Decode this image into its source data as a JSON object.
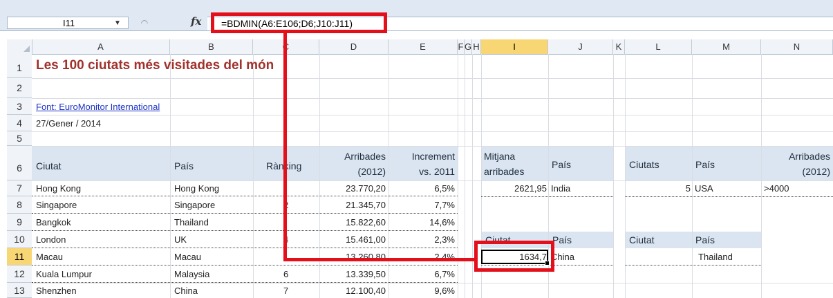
{
  "name_box": {
    "value": "I11"
  },
  "formula_bar": {
    "fx": "fx",
    "formula": "=BDMIN(A6:E106;D6;J10:J11)"
  },
  "columns": [
    "A",
    "B",
    "C",
    "D",
    "E",
    "F",
    "G",
    "H",
    "I",
    "J",
    "K",
    "L",
    "M",
    "N"
  ],
  "selected_column": "I",
  "rows": [
    "1",
    "2",
    "3",
    "4",
    "5",
    "6",
    "7",
    "8",
    "9",
    "10",
    "11",
    "12",
    "13"
  ],
  "selected_row": "11",
  "sheet": {
    "title": "Les 100 ciutats més visitades del món",
    "source": "Font: EuroMonitor International",
    "date": "27/Gener / 2014",
    "headers": {
      "ciutat": "Ciutat",
      "pais": "País",
      "ranking": "Rànking",
      "arribades_1": "Arribades",
      "arribades_2": "(2012)",
      "increment_1": "Increment",
      "increment_2": "vs. 2011"
    },
    "data_rows": [
      {
        "ciutat": "Hong Kong",
        "pais": "Hong Kong",
        "ranking": "",
        "arribades": "23.770,20",
        "increment": "6,5%"
      },
      {
        "ciutat": "Singapore",
        "pais": "Singapore",
        "ranking": "2",
        "arribades": "21.345,70",
        "increment": "7,7%"
      },
      {
        "ciutat": "Bangkok",
        "pais": "Thailand",
        "ranking": "",
        "arribades": "15.822,60",
        "increment": "14,6%"
      },
      {
        "ciutat": "London",
        "pais": "UK",
        "ranking": "4",
        "arribades": "15.461,00",
        "increment": "2,3%"
      },
      {
        "ciutat": "Macau",
        "pais": "Macau",
        "ranking": "",
        "arribades": "13.260,80",
        "increment": "2,4%"
      },
      {
        "ciutat": "Kuala Lumpur",
        "pais": "Malaysia",
        "ranking": "6",
        "arribades": "13.339,50",
        "increment": "6,7%"
      },
      {
        "ciutat": "Shenzhen",
        "pais": "China",
        "ranking": "7",
        "arribades": "12.100,40",
        "increment": "9,6%"
      }
    ],
    "box1": {
      "h1a": "Mitjana",
      "h1b": "arribades",
      "h2": "País",
      "v1": "2621,95",
      "v2": "India"
    },
    "box2": {
      "h1": "Ciutats",
      "h2": "País",
      "h3a": "Arribades",
      "h3b": "(2012)",
      "v1": "5",
      "v2": "USA",
      "v3": ">4000"
    },
    "box3": {
      "h1": "Ciutat",
      "h2": "País",
      "v1": "1634,7",
      "v2": "China"
    },
    "box4": {
      "h1": "Ciutat",
      "h2": "País",
      "v2": "Thailand"
    }
  },
  "colors": {
    "highlight": "#e3101c",
    "title": "#a0322d",
    "selected_header": "#f8d673",
    "header_fill": "#dbe5f1"
  }
}
